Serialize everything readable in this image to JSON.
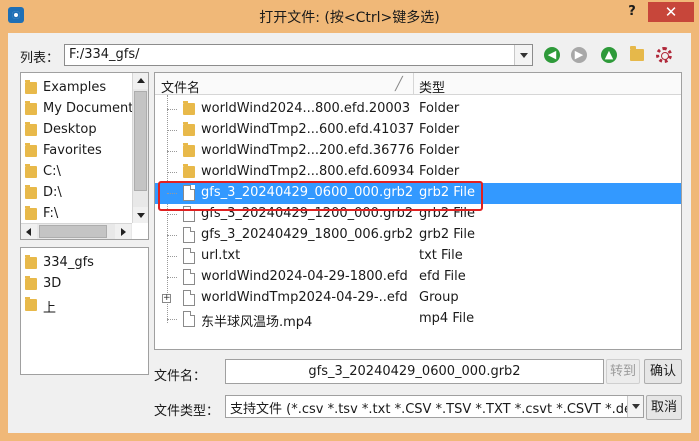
{
  "window": {
    "title": "打开文件: (按<Ctrl>键多选)",
    "help_label": "?",
    "close_label": "✕"
  },
  "toolbar": {
    "look_in_label": "列表：",
    "look_in_value": "F:/334_gfs/",
    "icons": [
      "back-icon",
      "forward-icon",
      "up-icon",
      "new-folder-icon",
      "settings-gear-icon"
    ],
    "colors": {
      "back": "#2e9a3a",
      "forward": "#a8a8a8",
      "up": "#2e9a3a"
    }
  },
  "sidebar": {
    "places": [
      "Examples",
      "My Documents",
      "Desktop",
      "Favorites",
      "C:\\",
      "D:\\",
      "F:\\"
    ],
    "recent": [
      "334_gfs",
      "3D",
      "上"
    ]
  },
  "file_list": {
    "columns": {
      "name": "文件名",
      "type": "类型"
    },
    "rows": [
      {
        "name": "worldWind2024...800.efd.20003",
        "type": "Folder",
        "kind": "folder"
      },
      {
        "name": "worldWindTmp2...600.efd.41037",
        "type": "Folder",
        "kind": "folder"
      },
      {
        "name": "worldWindTmp2...200.efd.36776",
        "type": "Folder",
        "kind": "folder"
      },
      {
        "name": "worldWindTmp2...800.efd.60934",
        "type": "Folder",
        "kind": "folder"
      },
      {
        "name": "gfs_3_20240429_0600_000.grb2",
        "type": "grb2 File",
        "kind": "file",
        "selected": true
      },
      {
        "name": "gfs_3_20240429_1200_000.grb2",
        "type": "grb2 File",
        "kind": "file"
      },
      {
        "name": "gfs_3_20240429_1800_006.grb2",
        "type": "grb2 File",
        "kind": "file"
      },
      {
        "name": "url.txt",
        "type": "txt File",
        "kind": "file"
      },
      {
        "name": "worldWind2024-04-29-1800.efd",
        "type": "efd File",
        "kind": "file"
      },
      {
        "name": "worldWindTmp2024-04-29-..efd",
        "type": "Group",
        "kind": "group"
      },
      {
        "name": "东半球风温场.mp4",
        "type": "mp4 File",
        "kind": "file"
      }
    ],
    "selection_color": "#3399ff",
    "highlight_color": "#e02020"
  },
  "bottom": {
    "filename_label": "文件名：",
    "filename_value": "gfs_3_20240429_0600_000.grb2",
    "goto_label": "转到",
    "ok_label": "确认",
    "filetype_label": "文件类型：",
    "filetype_value": "支持文件 (*.csv *.tsv *.txt *.CSV *.TSV *.TXT *.csvt *.CSVT *.dem",
    "cancel_label": "取消"
  }
}
